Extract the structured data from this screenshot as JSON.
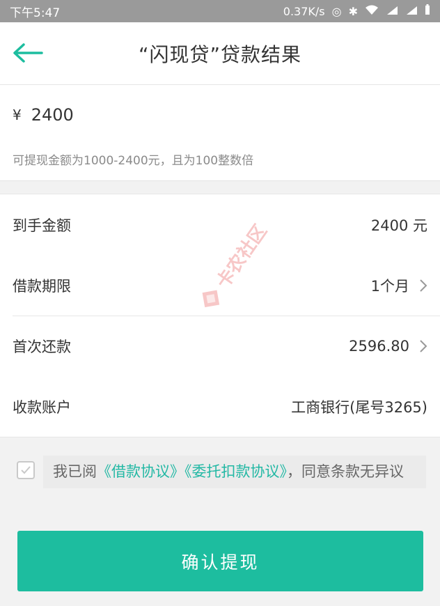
{
  "status": {
    "time": "下午5:47",
    "speed": "0.37K/s"
  },
  "nav": {
    "title": "“闪现贷”贷款结果"
  },
  "amount": {
    "currency": "¥",
    "value": "2400",
    "hint": "可提现金额为1000-2400元，且为100整数倍"
  },
  "details": {
    "received_label": "到手金额",
    "received_value": "2400 元",
    "term_label": "借款期限",
    "term_value": "1个月",
    "first_repay_label": "首次还款",
    "first_repay_value": "2596.80",
    "account_label": "收款账户",
    "account_value": "工商银行(尾号3265)"
  },
  "agreement": {
    "prefix": "我已阅",
    "link1": "《借款协议》",
    "link2": "《委托扣款协议》",
    "suffix": "，同意条款无异议"
  },
  "confirm_label": "确认提现",
  "watermark": "卡农社区",
  "colors": {
    "accent": "#1dbd9f",
    "link": "#22b8a4"
  }
}
